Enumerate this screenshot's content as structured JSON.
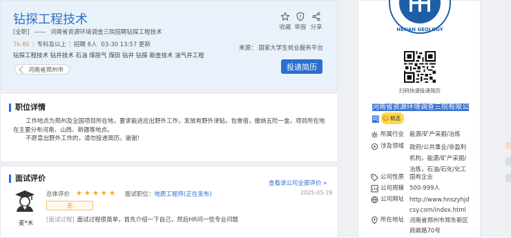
{
  "job": {
    "title": "钻探工程技术",
    "type": "[全职]",
    "dash": "——",
    "recruit_line": "河南省资源环境调查三院招聘钻探工程技术",
    "salary": "7k-8k",
    "education": "专科及以上",
    "headcount": "招聘 6人",
    "updated": "03-30 13:57 更新",
    "tags": "钻探工程技术 钻井技术 石油 煤层气 煤田 钻井 钻探 勘查技术 油气井工程",
    "location": "河南省郑州市",
    "source": "来源：  国家大学生就业服务平台",
    "actions": [
      {
        "label": "收藏",
        "icon": "star-outline-icon"
      },
      {
        "label": "举报",
        "icon": "report-shield-icon"
      },
      {
        "label": "分享",
        "icon": "share-icon"
      }
    ],
    "apply_label": "投递简历"
  },
  "detail": {
    "section_title": "职位详情",
    "paragraph1": "工作地点为郑州及全国项目所在地，要求能适应出野外工作，发放有野外津贴，包食宿，缴纳五险一金。项目所在地在主要分布河南、山西、新疆等地点。",
    "paragraph2": "不愿意出野外工作的，请勿投递简历。谢谢！"
  },
  "interview": {
    "section_title": "面试评价",
    "view_all": "查看该公司全部评价 »",
    "reviewer": "麦*木",
    "rating_label": "总体评价",
    "stars": 5,
    "position_label": "面试职位：",
    "position_value": "地质工程师(正在发布)",
    "date": "2025-05-28",
    "difficulty": "无",
    "process_tag": "[面试过程]",
    "process_text": "面试过程很简单，首先介绍一下自己，然后HR问一些专业问题"
  },
  "company": {
    "logo_text": "HENAN GEOLOGY",
    "qr_label": "扫码快速投递简历",
    "name": "河南省资源环境调查三院有限公司",
    "verified": "精选",
    "rows": [
      {
        "key": "所属行业",
        "value": "能源/矿产采掘/冶炼",
        "icon": "industry-icon"
      },
      {
        "key": "涉及领域",
        "value": "政府/公共事业/非盈利机构，能源/矿产采掘/冶炼，石油/石化/化工",
        "icon": "domain-icon"
      },
      {
        "key": "公司性质",
        "value": "国有企业",
        "icon": "tag-icon"
      },
      {
        "key": "公司规模",
        "value": "500-999人",
        "icon": "scale-icon"
      },
      {
        "key": "公司网址",
        "value": "http://www.hnszyhjdcsy.com/index.html",
        "icon": "globe-icon"
      },
      {
        "key": "所在地址",
        "value": "河南省郑州市郑东新区商鼎路70号",
        "icon": "location-icon"
      }
    ]
  },
  "colors": {
    "accent": "#2c6fd0",
    "salary": "#e98b2c",
    "header_bg": "#e9f2fb",
    "star": "#f3a321"
  }
}
